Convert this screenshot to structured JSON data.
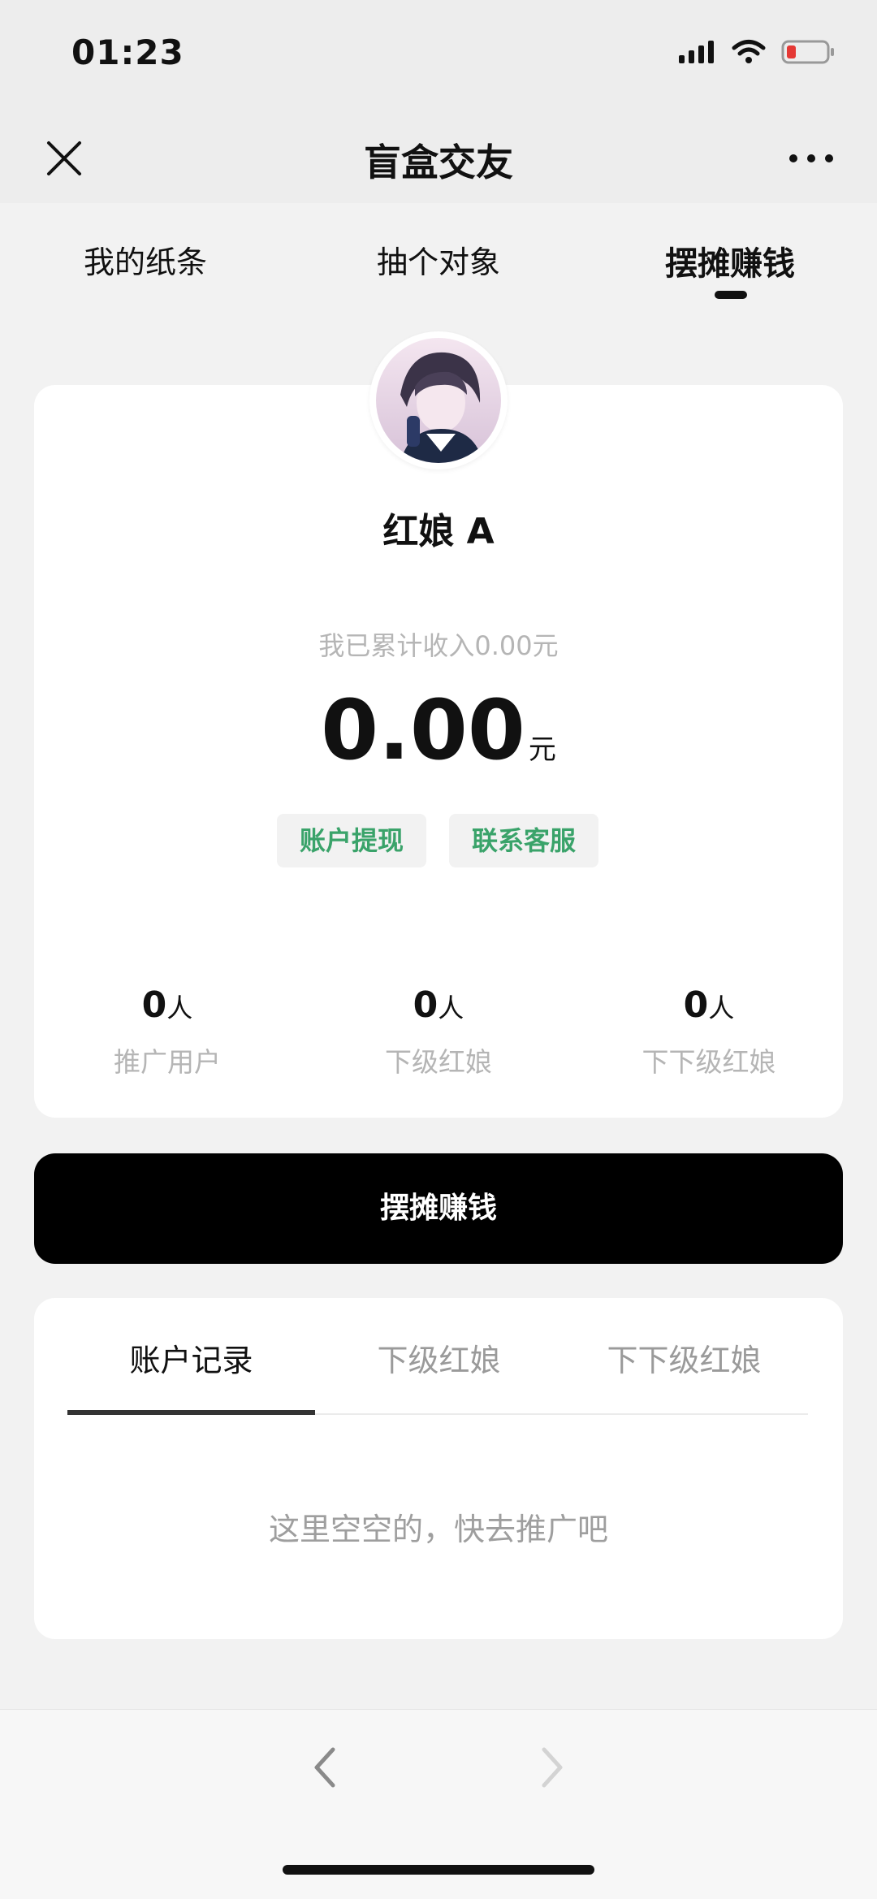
{
  "status": {
    "time": "01:23"
  },
  "nav": {
    "title": "盲盒交友"
  },
  "top_tabs": [
    {
      "label": "我的纸条",
      "active": false
    },
    {
      "label": "抽个对象",
      "active": false
    },
    {
      "label": "摆摊赚钱",
      "active": true
    }
  ],
  "profile": {
    "nickname": "红娘 A",
    "income_label": "我已累计收入0.00元",
    "balance": "0.00",
    "balance_unit": "元",
    "withdraw_label": "账户提现",
    "service_label": "联系客服"
  },
  "stats": [
    {
      "value": "0",
      "unit": "人",
      "label": "推广用户"
    },
    {
      "value": "0",
      "unit": "人",
      "label": "下级红娘"
    },
    {
      "value": "0",
      "unit": "人",
      "label": "下下级红娘"
    }
  ],
  "main_button": {
    "label": "摆摊赚钱"
  },
  "record_tabs": [
    {
      "label": "账户记录",
      "active": true
    },
    {
      "label": "下级红娘",
      "active": false
    },
    {
      "label": "下下级红娘",
      "active": false
    }
  ],
  "empty_state": {
    "text": "这里空空的，快去推广吧"
  },
  "colors": {
    "accent_green": "#3aa36a",
    "battery_low": "#e53935",
    "primary_button": "#000000"
  },
  "icons": [
    "close-icon",
    "more-icon",
    "signal-icon",
    "wifi-icon",
    "battery-icon",
    "back-arrow-icon",
    "forward-arrow-icon"
  ]
}
